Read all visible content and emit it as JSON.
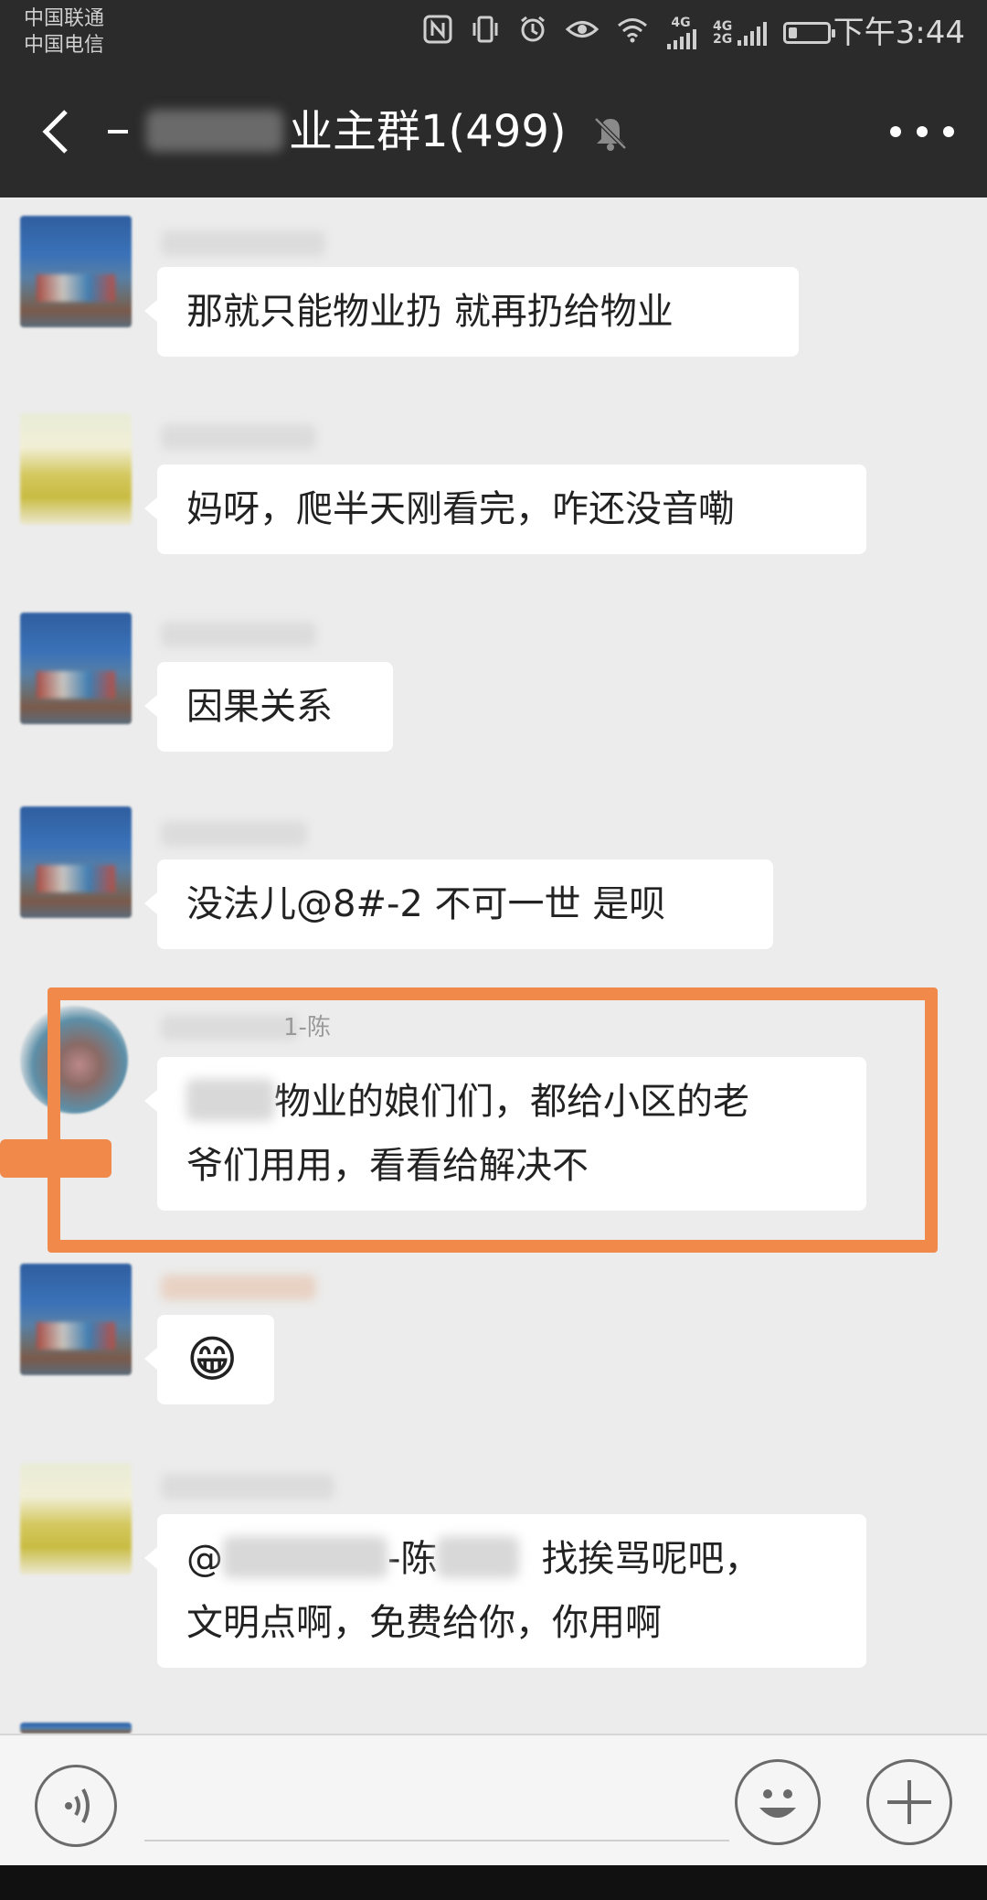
{
  "status_bar": {
    "carrier_1": "中国联通",
    "carrier_2": "中国电信",
    "network_1": "4G",
    "network_2_top": "4G",
    "network_2_bottom": "2G",
    "time": "下午3:44"
  },
  "header": {
    "title_visible_suffix": "业主群1(499)",
    "muted": true
  },
  "messages": [
    {
      "avatar": "blue-photo",
      "sender_label": "",
      "text": "那就只能物业扔 就再扔给物业"
    },
    {
      "avatar": "yellow-photo",
      "sender_label": "",
      "text": "妈呀，爬半天刚看完，咋还没音嘞"
    },
    {
      "avatar": "blue-photo",
      "sender_label": "",
      "text": "因果关系"
    },
    {
      "avatar": "blue-photo",
      "sender_label": "",
      "text": "没法儿@8#-2 不可一世  是呗"
    },
    {
      "avatar": "portrait-photo",
      "sender_label": "1-陈",
      "line_1": "物业的娘们们，都给小区的老",
      "line_2": "爷们用用，看看给解决不",
      "highlighted": true
    },
    {
      "avatar": "blue-photo",
      "sender_label": "",
      "emoji": "😁"
    },
    {
      "avatar": "yellow-photo",
      "sender_label": "",
      "line_1_prefix": "@",
      "line_1_mid": "-陈",
      "line_1_suffix": "找挨骂呢吧，",
      "line_2": "文明点啊，免费给你，你用啊"
    }
  ],
  "colors": {
    "header_bg": "#2b2b2b",
    "chat_bg": "#ececec",
    "bubble_bg": "#ffffff",
    "highlight": "#f0894a"
  }
}
